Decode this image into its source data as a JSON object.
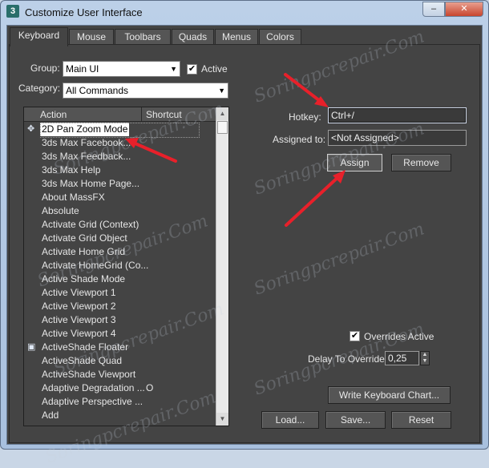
{
  "window": {
    "title": "Customize User Interface",
    "icon_glyph": "3",
    "minimize_glyph": "–",
    "close_glyph": "✕"
  },
  "tabs": [
    {
      "label": "Keyboard",
      "active": true
    },
    {
      "label": "Mouse"
    },
    {
      "label": "Toolbars"
    },
    {
      "label": "Quads"
    },
    {
      "label": "Menus"
    },
    {
      "label": "Colors"
    }
  ],
  "group": {
    "label": "Group:",
    "value": "Main UI"
  },
  "active_checkbox": {
    "label": "Active",
    "checked": true
  },
  "category": {
    "label": "Category:",
    "value": "All Commands"
  },
  "list": {
    "header_action": "Action",
    "header_shortcut": "Shortcut",
    "rows": [
      {
        "icon": "pan-zoom",
        "action": "2D Pan Zoom Mode",
        "shortcut": "",
        "selected": true
      },
      {
        "action": "3ds Max Facebook...",
        "shortcut": ""
      },
      {
        "action": "3ds Max Feedback...",
        "shortcut": ""
      },
      {
        "action": "3ds Max Help",
        "shortcut": ""
      },
      {
        "action": "3ds Max Home Page...",
        "shortcut": ""
      },
      {
        "action": "About MassFX",
        "shortcut": ""
      },
      {
        "action": "Absolute",
        "shortcut": ""
      },
      {
        "action": "Activate Grid (Context)",
        "shortcut": ""
      },
      {
        "action": "Activate Grid Object",
        "shortcut": ""
      },
      {
        "action": "Activate Home Grid",
        "shortcut": ""
      },
      {
        "action": "Activate HomeGrid (Co...",
        "shortcut": ""
      },
      {
        "action": "Active Shade Mode",
        "shortcut": ""
      },
      {
        "action": "Active Viewport 1",
        "shortcut": ""
      },
      {
        "action": "Active Viewport 2",
        "shortcut": ""
      },
      {
        "action": "Active Viewport 3",
        "shortcut": ""
      },
      {
        "action": "Active Viewport 4",
        "shortcut": ""
      },
      {
        "icon": "activeshade",
        "action": "ActiveShade Floater",
        "shortcut": ""
      },
      {
        "action": "ActiveShade Quad",
        "shortcut": ""
      },
      {
        "action": "ActiveShade Viewport",
        "shortcut": ""
      },
      {
        "action": "Adaptive Degradation ...",
        "shortcut": "O"
      },
      {
        "action": "Adaptive Perspective ...",
        "shortcut": ""
      },
      {
        "action": "Add",
        "shortcut": ""
      }
    ]
  },
  "hotkey": {
    "label": "Hotkey:",
    "value": "Ctrl+/"
  },
  "assigned_to": {
    "label": "Assigned to:",
    "value": "<Not Assigned>"
  },
  "buttons": {
    "assign": "Assign",
    "remove": "Remove",
    "write_chart": "Write Keyboard Chart...",
    "load": "Load...",
    "save": "Save...",
    "reset": "Reset"
  },
  "overrides_active": {
    "label": "Overrides Active",
    "checked": true
  },
  "delay": {
    "label": "Delay To Override:",
    "value": "0,25"
  },
  "watermark_text": "Soringpcrepair.Com",
  "colors": {
    "arrow": "#e8202a",
    "panel": "#444444"
  }
}
